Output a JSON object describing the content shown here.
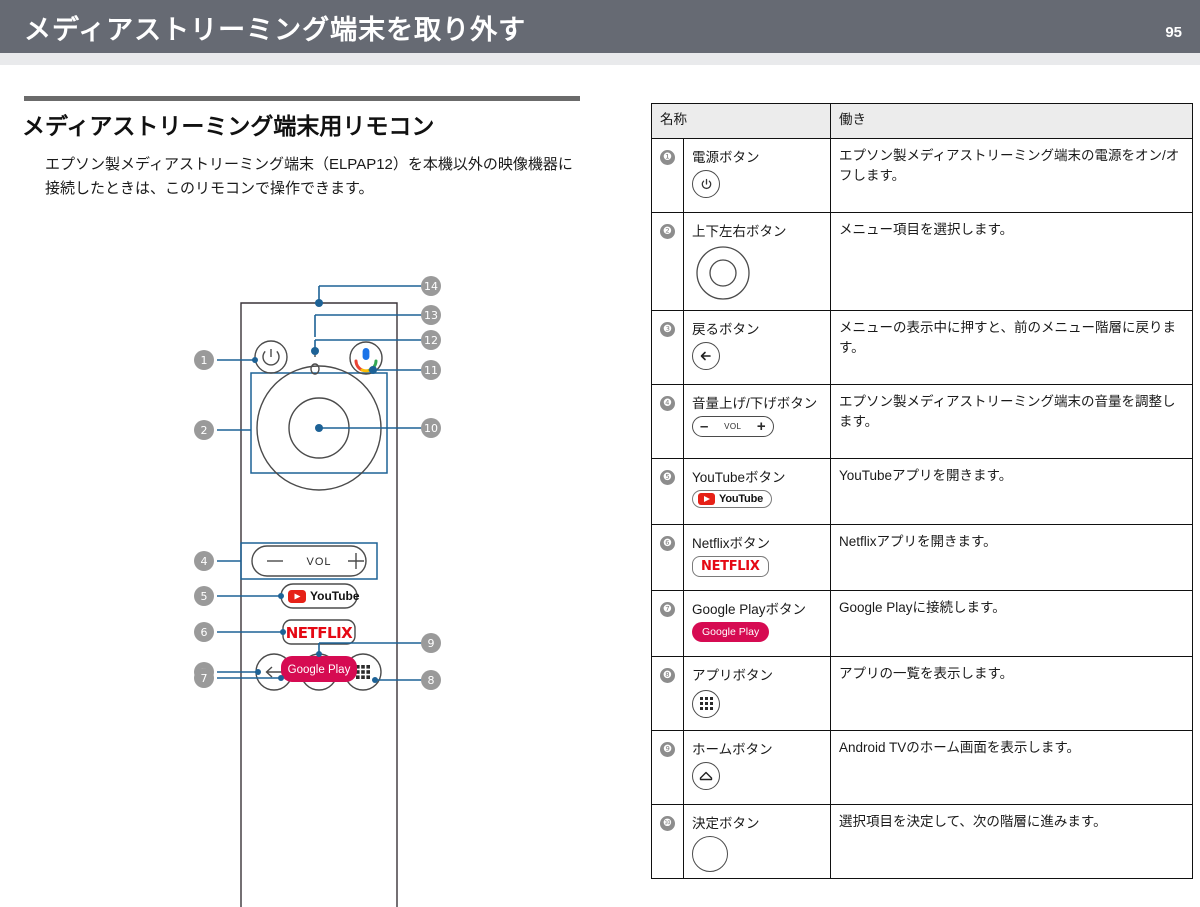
{
  "header": {
    "title": "メディアストリーミング端末を取り外す",
    "page_number": "95",
    "bar_color": "#666a73"
  },
  "section": {
    "heading": "メディアストリーミング端末用リモコン",
    "paragraph": "エプソン製メディアストリーミング端末（ELPAP12）を本機以外の映像機器に接続したときは、このリモコンで操作できます。"
  },
  "diagram": {
    "name": "media-streaming-remote",
    "vol_label": "VOL",
    "youtube_label": "YouTube",
    "netflix_label": "NETFLIX",
    "googleplay_label": "Google Play",
    "callouts": [
      {
        "n": "❶",
        "side": "left",
        "target": "power-button"
      },
      {
        "n": "❷",
        "side": "left",
        "target": "dpad-button"
      },
      {
        "n": "❸",
        "side": "left",
        "target": "back-button"
      },
      {
        "n": "❹",
        "side": "left",
        "target": "volume-button"
      },
      {
        "n": "❺",
        "side": "left",
        "target": "youtube-button"
      },
      {
        "n": "❻",
        "side": "left",
        "target": "netflix-button"
      },
      {
        "n": "❼",
        "side": "left",
        "target": "googleplay-button"
      },
      {
        "n": "❽",
        "side": "right",
        "target": "apps-button"
      },
      {
        "n": "❾",
        "side": "right",
        "target": "home-button"
      },
      {
        "n": "❿",
        "side": "right",
        "target": "ok-button"
      },
      {
        "n": "⑩",
        "side": "right",
        "target": "mic-button"
      },
      {
        "n": "⑫",
        "side": "right",
        "target": "indicator-lamp"
      },
      {
        "n": "⑬",
        "side": "right",
        "target": "mic-hole"
      },
      {
        "n": "⑭",
        "side": "right",
        "target": "remote-top-edge"
      }
    ],
    "callout_labels": {
      "c1": "1",
      "c2": "2",
      "c3": "3",
      "c4": "4",
      "c5": "5",
      "c6": "6",
      "c7": "7",
      "c8": "8",
      "c9": "9",
      "c10": "10",
      "c11": "11",
      "c12": "12",
      "c13": "13",
      "c14": "14"
    }
  },
  "table": {
    "headers": {
      "name": "名称",
      "function": "働き"
    },
    "rows": [
      {
        "num": "❶",
        "name": "電源ボタン",
        "icon": "power-icon",
        "function": "エプソン製メディアストリーミング端末の電源をオン/オフします。"
      },
      {
        "num": "❷",
        "name": "上下左右ボタン",
        "icon": "dpad-icon",
        "function": "メニュー項目を選択します。"
      },
      {
        "num": "❸",
        "name": "戻るボタン",
        "icon": "back-arrow-icon",
        "function": "メニューの表示中に押すと、前のメニュー階層に戻ります。"
      },
      {
        "num": "❹",
        "name": "音量上げ/下げボタン",
        "icon": "volume-icon",
        "icon_label": "VOL",
        "function": "エプソン製メディアストリーミング端末の音量を調整します。"
      },
      {
        "num": "❺",
        "name": "YouTubeボタン",
        "icon": "youtube-logo-icon",
        "icon_label": "YouTube",
        "function": "YouTubeアプリを開きます。"
      },
      {
        "num": "❻",
        "name": "Netflixボタン",
        "icon": "netflix-logo-icon",
        "icon_label": "NETFLIX",
        "function": "Netflixアプリを開きます。"
      },
      {
        "num": "❼",
        "name": "Google Playボタン",
        "icon": "googleplay-logo-icon",
        "icon_label": "Google Play",
        "function": "Google Playに接続します。"
      },
      {
        "num": "❽",
        "name": "アプリボタン",
        "icon": "apps-grid-icon",
        "function": "アプリの一覧を表示します。"
      },
      {
        "num": "❾",
        "name": "ホームボタン",
        "icon": "home-icon",
        "function": "Android TVのホーム画面を表示します。"
      },
      {
        "num": "❿",
        "name": "決定ボタン",
        "icon": "ok-circle-icon",
        "function": "選択項目を決定して、次の階層に進みます。"
      }
    ]
  },
  "colors": {
    "header_gray": "#666a73",
    "callout_gray": "#8d8d8d",
    "leader_blue": "#1d6296",
    "netflix_red": "#e50914",
    "youtube_red": "#e62117",
    "googleplay_pink": "#d60b52",
    "table_header_bg": "#ececec"
  }
}
